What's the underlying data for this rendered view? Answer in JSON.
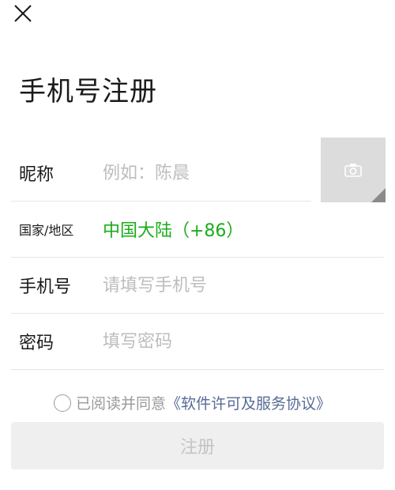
{
  "header": {
    "close_icon": "close-icon",
    "title": "手机号注册"
  },
  "form": {
    "nickname": {
      "label": "昵称",
      "placeholder": "例如：陈晨",
      "value": ""
    },
    "region": {
      "label": "国家/地区",
      "value": "中国大陆（+86）"
    },
    "phone": {
      "label": "手机号",
      "placeholder": "请填写手机号",
      "value": ""
    },
    "password": {
      "label": "密码",
      "placeholder": "填写密码",
      "value": ""
    }
  },
  "avatar": {
    "icon": "camera-icon"
  },
  "agreement": {
    "checked": false,
    "text": "已阅读并同意",
    "link": "《软件许可及服务协议》"
  },
  "register_button": {
    "label": "注册",
    "enabled": false
  },
  "colors": {
    "accent_green": "#1aad19",
    "link_blue": "#576b95",
    "placeholder_gray": "#bdbdbd",
    "disabled_button_bg": "#efefef"
  }
}
